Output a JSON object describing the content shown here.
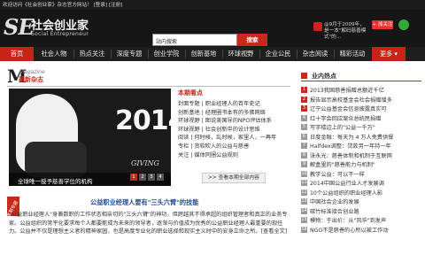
{
  "topbar": {
    "welcome": "欢迎访问《社会创业家》杂志官方网站！",
    "links": "[登录] [注册]"
  },
  "header": {
    "logo_mark": "SE",
    "logo_cn": "社会创业家",
    "logo_en": "Social Entrepreneur",
    "search_value": "站内搜索",
    "search_button": "搜索",
    "weibo_text": "@9月于2009年，是一本\"解码慈善模式\"的...",
    "follow_label": "+ 加关注"
  },
  "nav": {
    "items": [
      "首页",
      "社会人物",
      "热点关注",
      "深度专题",
      "创业学院",
      "创新基地",
      "环球视野",
      "企业公民",
      "杂志阅读",
      "精彩活动"
    ],
    "more": "更多"
  },
  "magazine": {
    "eng": "Magazine",
    "cn": "最新杂志",
    "cover_year": "2014",
    "cover_giving": "GIVING",
    "caption": "全球唯一授予慈善学位的机构",
    "pages": [
      "1",
      "2",
      "3",
      "4"
    ]
  },
  "highlights": {
    "title": "本期看点",
    "lines": [
      "封面专题 | 职业经理人的百年史记",
      "创新基地 | 经理圈书本有的多佛网络",
      "环球视野 | 图说美国导的NPO评估体系",
      "环球视野 | 社会创新中的设计思维",
      "阅读 | 何时候，乱时候，家里人，一再年",
      "专栏 | 货软吹入的公益与慈善",
      "关注 | 媒体同圈公益规则"
    ],
    "all_button": ">> 查看本期全部内容"
  },
  "article": {
    "ribbon": "本期专题",
    "headline": "公益职业经理人要有\"三头六臂\"的技能",
    "body": "\"公益职业经理人\"身兼数职的工作状态相亲切的\"三头六臂\"的神功，但跨越其不得承超的组织管理者和真正的业务专家。公益组织的常平化要求每个人都要能成为未来的领导者，逐渐与价值成为优秀的公益职业经理人最重要的现任力。公益并不仅是理想主义者的精神家园，也是高度专业化的职业选择和现实主义时中的安身立命之所。[查看全文]"
  },
  "sidebar": {
    "title": "业内热点",
    "items": [
      "2013我国慈善捐赠总额近千亿",
      "报告显示高校基金会社会捐赠增多",
      "辽宁公益基金会信息披露真实可",
      "红十字会回应案众总统民捐赠",
      "写字楼边上的\"公益一千万\"",
      "日度金融：每天为 4 万人免费供餐",
      "Halfdex调整：贷款另一年持一年",
      "张永光：慈善体制和机制于互联网",
      "解盒里的\"慈善能力与机制\"",
      "教学公益：可以不一样",
      "2014中国公益行业人才发展调",
      "10个公益组织的职业经理人影",
      "中国社会企业的发展",
      "碳竹标准接合创业路",
      "模物：于出价：从\"风华\"到发声",
      "NGO不是慈善的心所以被工作动"
    ]
  },
  "colors": {
    "accent": "#c9281c",
    "header_bg": "#161616",
    "link_blue": "#224c9a"
  }
}
